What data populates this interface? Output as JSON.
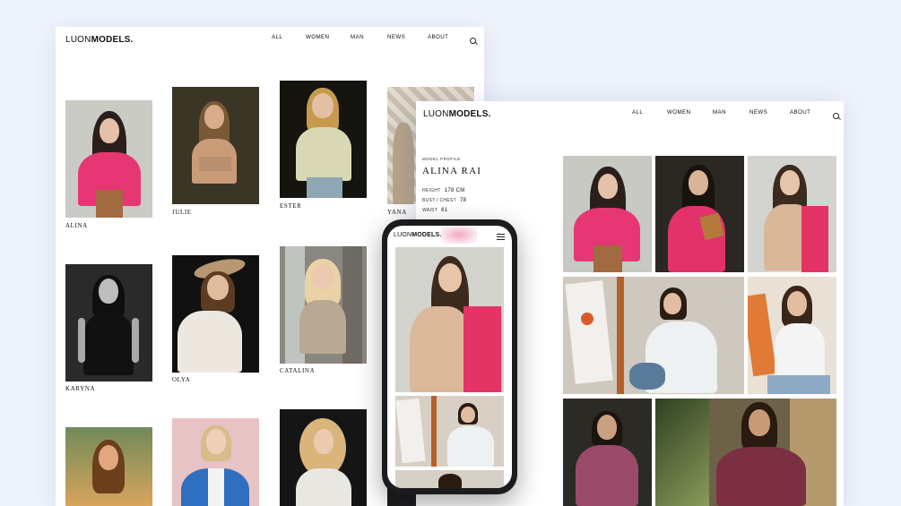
{
  "brand": {
    "light": "LUON",
    "bold": "MODELS."
  },
  "nav": [
    "ALL",
    "WOMEN",
    "MAN",
    "NEWS",
    "ABOUT"
  ],
  "grid_models": [
    "ALINA",
    "JULIE",
    "ESTER",
    "YANA",
    "KARYNA",
    "OLYA",
    "CATALINA"
  ],
  "profile": {
    "section_label": "MODEL PROFILE",
    "name": "ALINA RAI",
    "stats": [
      {
        "label": "HEIGHT",
        "value": "178 CM"
      },
      {
        "label": "BUST / CHEST",
        "value": "78"
      },
      {
        "label": "WAIST",
        "value": "61"
      }
    ]
  },
  "colors": {
    "accent": "#e5305f",
    "background": "#eef2fb",
    "phone": "#1c1c1e"
  }
}
